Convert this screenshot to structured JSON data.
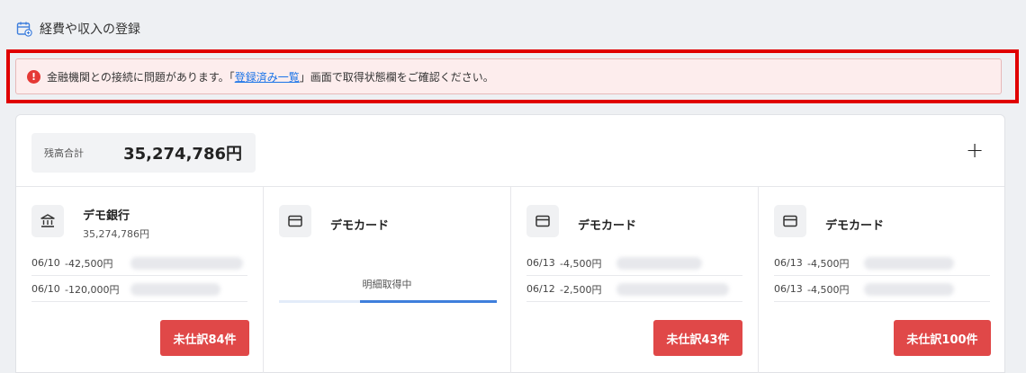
{
  "header": {
    "title": "経費や収入の登録",
    "icon": "calendar-icon"
  },
  "alert": {
    "icon": "error-icon",
    "text_before": "金融機関との接続に問題があります。「",
    "link_text": "登録済み一覧",
    "text_after": "」画面で取得状態欄をご確認ください。"
  },
  "summary": {
    "total_label": "残高合計",
    "total_value": "35,274,786円",
    "add_label": "+"
  },
  "accounts": [
    {
      "name": "デモ銀行",
      "balance": "35,274,786円",
      "icon": "bank-icon",
      "transactions": [
        {
          "date": "06/10",
          "amount": "-42,500円"
        },
        {
          "date": "06/10",
          "amount": "-120,000円"
        }
      ],
      "button": "未仕訳84件"
    },
    {
      "name": "デモカード",
      "icon": "credit-card-icon",
      "status": "明細取得中",
      "progress": 0.63
    },
    {
      "name": "デモカード",
      "icon": "credit-card-icon",
      "transactions": [
        {
          "date": "06/13",
          "amount": "-4,500円"
        },
        {
          "date": "06/12",
          "amount": "-2,500円"
        }
      ],
      "button": "未仕訳43件"
    },
    {
      "name": "デモカード",
      "icon": "credit-card-icon",
      "transactions": [
        {
          "date": "06/13",
          "amount": "-4,500円"
        },
        {
          "date": "06/13",
          "amount": "-4,500円"
        }
      ],
      "button": "未仕訳100件"
    }
  ],
  "colors": {
    "alert_border": "#e00000",
    "alert_bg": "#fdeded",
    "link": "#1a73e8",
    "button": "#e04848",
    "progress": "#3f7fdc"
  }
}
